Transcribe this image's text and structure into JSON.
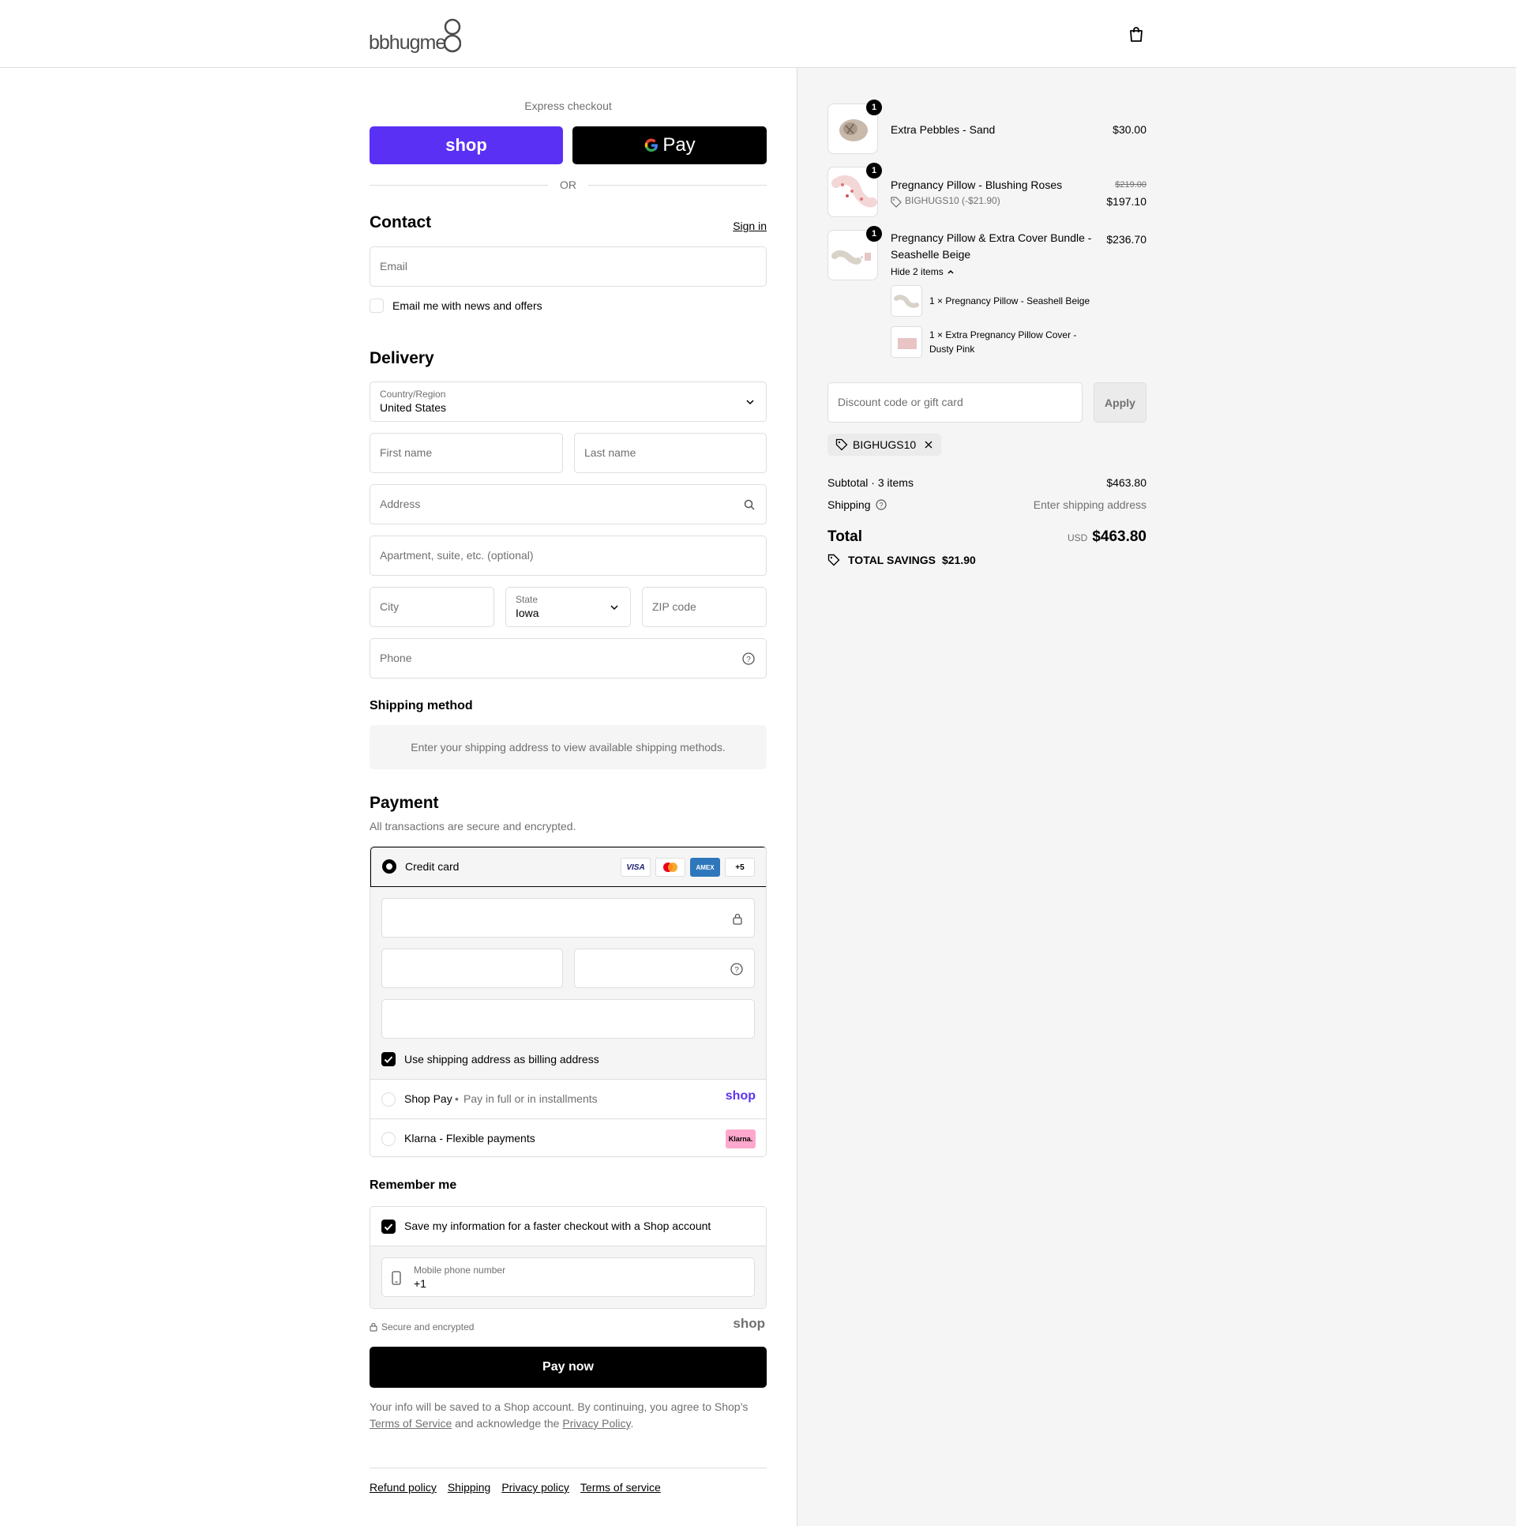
{
  "header": {
    "logo_text": "bbhugme",
    "bag_icon": "shopping-bag-icon"
  },
  "express": {
    "label": "Express checkout",
    "shop_label": "shop",
    "gpay_label": "Pay",
    "or_label": "OR"
  },
  "contact": {
    "title": "Contact",
    "signin": "Sign in",
    "email_placeholder": "Email",
    "news_label": "Email me with news and offers"
  },
  "delivery": {
    "title": "Delivery",
    "country_label": "Country/Region",
    "country_value": "United States",
    "first_name": "First name",
    "last_name": "Last name",
    "address": "Address",
    "apartment": "Apartment, suite, etc. (optional)",
    "city": "City",
    "state_label": "State",
    "state_value": "Iowa",
    "zip": "ZIP code",
    "phone": "Phone"
  },
  "shipping_method": {
    "title": "Shipping method",
    "message": "Enter your shipping address to view available shipping methods."
  },
  "payment": {
    "title": "Payment",
    "subtitle": "All transactions are secure and encrypted.",
    "credit_card": "Credit card",
    "cards": [
      "VISA",
      "MC",
      "AMEX",
      "+5"
    ],
    "billing_label": "Use shipping address as billing address",
    "shop_pay": "Shop Pay",
    "shop_pay_sub": "Pay in full or in installments",
    "shop_pay_logo": "shop",
    "klarna": "Klarna - Flexible payments",
    "klarna_logo": "Klarna."
  },
  "remember": {
    "title": "Remember me",
    "save_label": "Save my information for a faster checkout with a Shop account",
    "mobile_label": "Mobile phone number",
    "mobile_value": "+1",
    "secure": "Secure and encrypted",
    "shop_logo": "shop"
  },
  "pay_now": "Pay now",
  "legal": {
    "text1": "Your info will be saved to a Shop account. By continuing, you agree to Shop’s ",
    "tos": "Terms of Service",
    "text2": " and acknowledge the ",
    "privacy": "Privacy Policy",
    "text3": "."
  },
  "footer": [
    "Refund policy",
    "Shipping",
    "Privacy policy",
    "Terms of service"
  ],
  "cart": {
    "items": [
      {
        "qty": "1",
        "name": "Extra Pebbles - Sand",
        "price": "$30.00"
      },
      {
        "qty": "1",
        "name": "Pregnancy Pillow - Blushing Roses",
        "discount": "BIGHUGS10 (-$21.90)",
        "old_price": "$219.00",
        "price": "$197.10"
      },
      {
        "qty": "1",
        "name": "Pregnancy Pillow & Extra Cover Bundle - Seashelle Beige",
        "price": "$236.70",
        "toggle": "Hide 2 items",
        "sub_items": [
          {
            "qty": "1 ×",
            "name": "Pregnancy Pillow - Seashell Beige"
          },
          {
            "qty": "1 ×",
            "name": "Extra Pregnancy Pillow Cover - Dusty Pink"
          }
        ]
      }
    ],
    "discount_placeholder": "Discount code or gift card",
    "apply": "Apply",
    "code": "BIGHUGS10",
    "subtotal_label": "Subtotal · 3 items",
    "subtotal_value": "$463.80",
    "shipping_label": "Shipping",
    "shipping_value": "Enter shipping address",
    "total_label": "Total",
    "currency": "USD",
    "total_value": "$463.80",
    "savings_label": "TOTAL SAVINGS",
    "savings_value": "$21.90"
  }
}
